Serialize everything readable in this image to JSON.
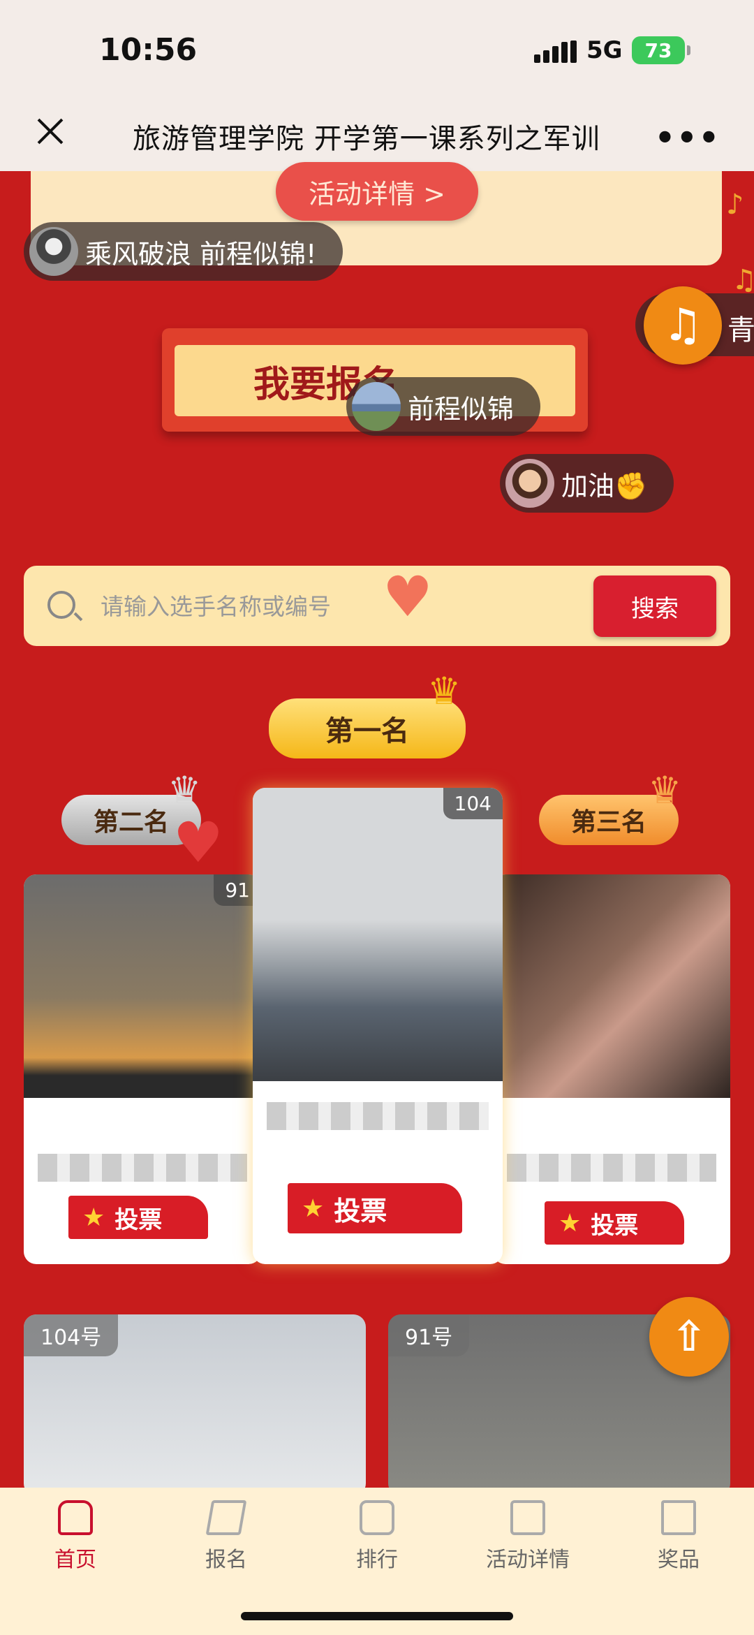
{
  "status_bar": {
    "time": "10:56",
    "network": "5G",
    "battery": "73"
  },
  "title_bar": {
    "title": "旅游管理学院 开学第一课系列之军训"
  },
  "activity_detail_button": "活动详情 >",
  "danmaku": [
    {
      "text": "乘风破浪 前程似锦!"
    },
    {
      "text": "前程似锦"
    },
    {
      "text": "加油✊"
    }
  ],
  "side_danmaku_text": "青",
  "signup_button": "我要报名",
  "search": {
    "placeholder": "请输入选手名称或编号",
    "button": "搜索"
  },
  "ranking": {
    "first": {
      "label": "第一名",
      "votes": "104",
      "vote_button": "投票"
    },
    "second": {
      "label": "第二名",
      "votes": "91",
      "vote_button": "投票"
    },
    "third": {
      "label": "第三名",
      "vote_button": "投票"
    }
  },
  "grid": [
    {
      "tag": "104号"
    },
    {
      "tag": "91号"
    }
  ],
  "tabs": [
    {
      "label": "首页"
    },
    {
      "label": "报名"
    },
    {
      "label": "排行"
    },
    {
      "label": "活动详情"
    },
    {
      "label": "奖品"
    }
  ],
  "colors": {
    "background": "#c71c1c",
    "accent": "#f08a14",
    "vote": "#d81d26",
    "active_tab": "#c8102e"
  }
}
